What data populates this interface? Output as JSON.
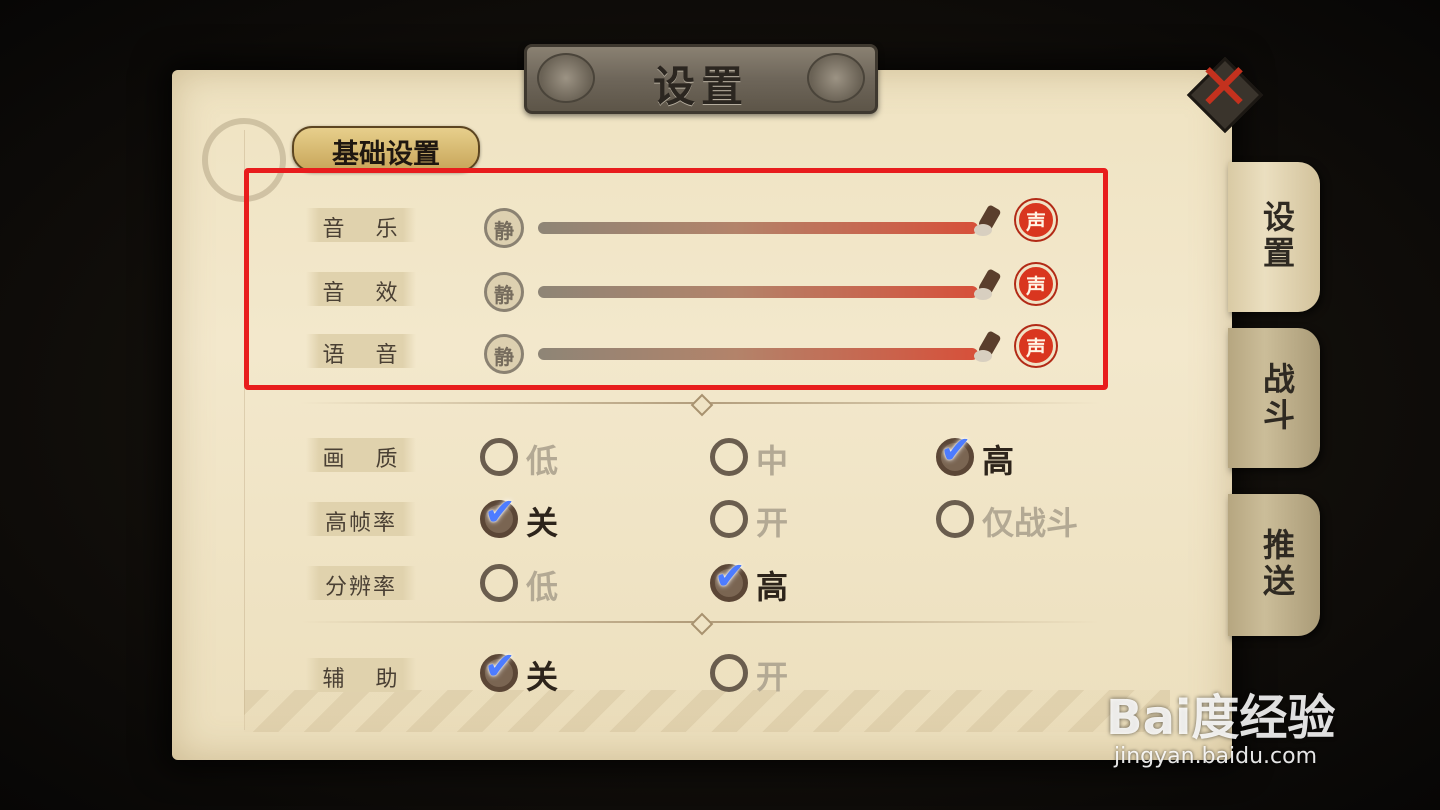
{
  "header": {
    "title": "设置"
  },
  "close": {
    "icon": "close-x-icon"
  },
  "tabs": [
    {
      "label": "设置",
      "active": true
    },
    {
      "label": "战斗",
      "active": false
    },
    {
      "label": "推送",
      "active": false
    }
  ],
  "section": {
    "title": "基础设置"
  },
  "audio": {
    "mute_label": "静",
    "sound_label": "声",
    "rows": [
      {
        "label": "音 乐",
        "level": 1.0
      },
      {
        "label": "音 效",
        "level": 1.0
      },
      {
        "label": "语 音",
        "level": 1.0
      }
    ]
  },
  "graphics": {
    "quality": {
      "label": "画 质",
      "options": [
        "低",
        "中",
        "高"
      ],
      "selected": "高"
    },
    "high_fps": {
      "label": "高帧率",
      "options": [
        "关",
        "开",
        "仅战斗"
      ],
      "selected": "关"
    },
    "resolution": {
      "label": "分辨率",
      "options": [
        "低",
        "高"
      ],
      "selected": "高"
    },
    "assist": {
      "label": "辅 助",
      "options": [
        "关",
        "开"
      ],
      "selected": "关"
    }
  },
  "watermark": {
    "brand": "Bai度经验",
    "url": "jingyan.baidu.com"
  },
  "colors": {
    "accent_red": "#e81d1d",
    "sound_red": "#d9361f",
    "check_blue": "#4d7cff"
  }
}
